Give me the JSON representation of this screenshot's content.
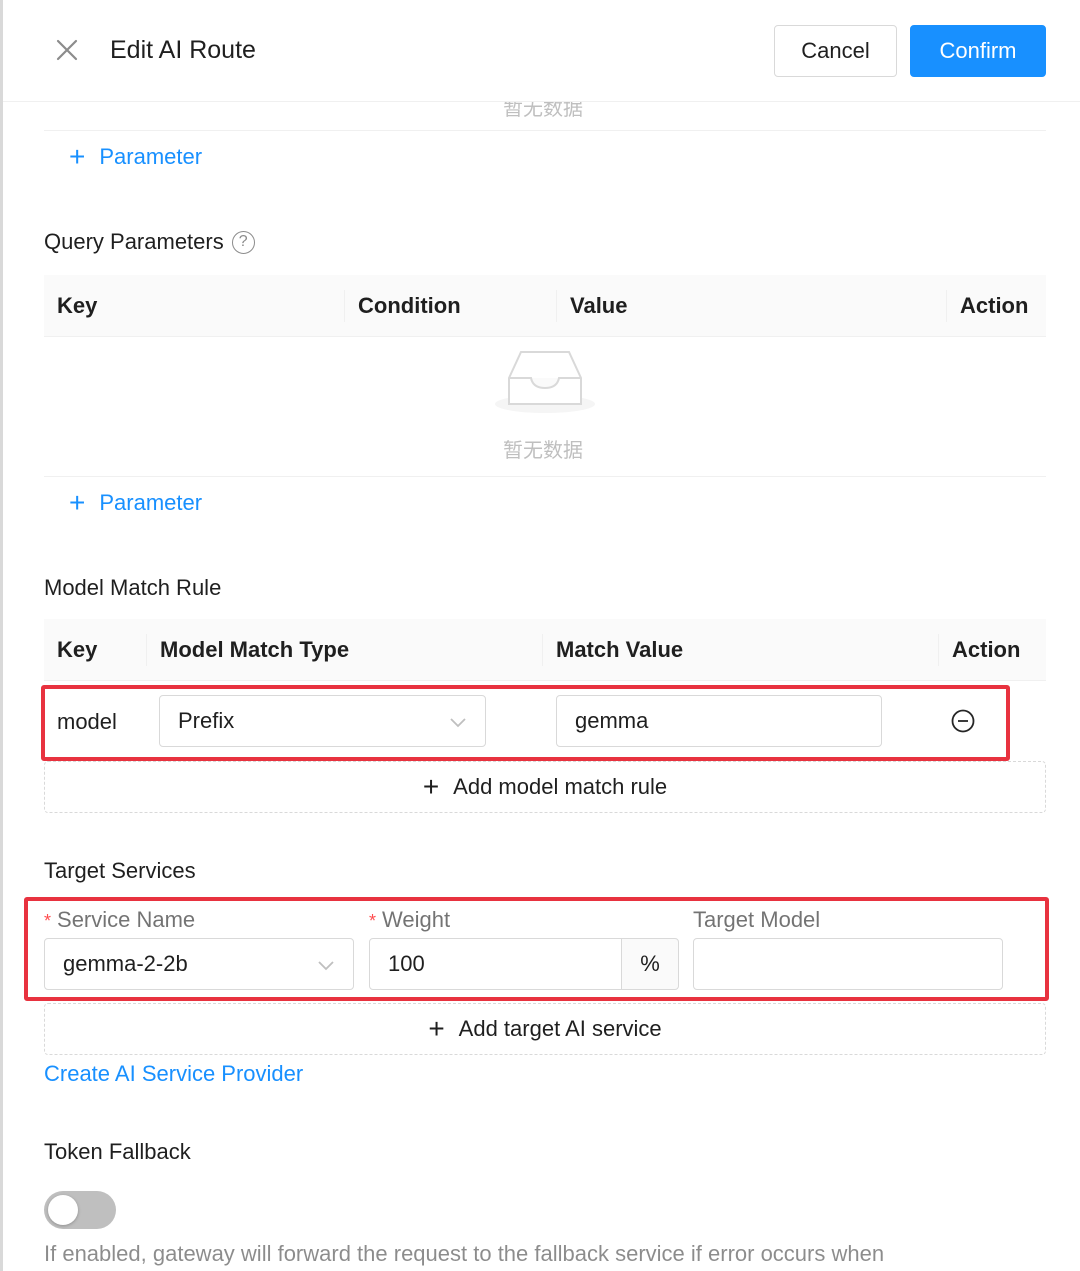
{
  "header": {
    "title": "Edit AI Route",
    "cancel_label": "Cancel",
    "confirm_label": "Confirm"
  },
  "empty_text": "暂无数据",
  "add_parameter_label": "Parameter",
  "query_parameters": {
    "label": "Query Parameters",
    "columns": [
      "Key",
      "Condition",
      "Value",
      "Action"
    ]
  },
  "model_match_rule": {
    "label": "Model Match Rule",
    "columns": [
      "Key",
      "Model Match Type",
      "Match Value",
      "Action"
    ],
    "rows": [
      {
        "key": "model",
        "match_type": "Prefix",
        "match_value": "gemma"
      }
    ],
    "add_label": "Add model match rule"
  },
  "target_services": {
    "label": "Target Services",
    "service_name_label": "Service Name",
    "weight_label": "Weight",
    "target_model_label": "Target Model",
    "service_name_value": "gemma-2-2b",
    "weight_value": "100",
    "weight_suffix": "%",
    "target_model_value": "",
    "add_label": "Add target AI service",
    "create_provider_label": "Create AI Service Provider"
  },
  "token_fallback": {
    "label": "Token Fallback",
    "enabled": false,
    "help": "If enabled, gateway will forward the request to the fallback service if error occurs when"
  },
  "colors": {
    "primary": "#1890ff",
    "highlight_box": "#e8323f",
    "required_mark": "#ff4d4f"
  }
}
